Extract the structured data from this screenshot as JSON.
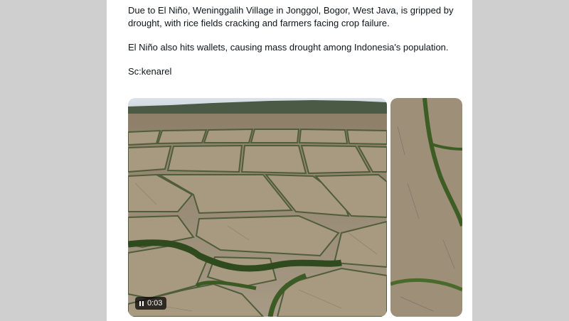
{
  "post": {
    "paragraph_1": "Due to El Niño, Weninggalih Village in Jonggol, Bogor, West Java, is gripped by drought, with rice fields cracking and farmers facing crop failure.",
    "paragraph_2": "El Niño also hits wallets, causing mass drought among Indonesia's population.",
    "credit": "Sc:kenarel"
  },
  "media": {
    "video_time": "0:03",
    "video_icon": "pause-icon"
  },
  "colors": {
    "background_bars": "#cfcfcf",
    "card": "#ffffff",
    "text": "#0f1419"
  }
}
